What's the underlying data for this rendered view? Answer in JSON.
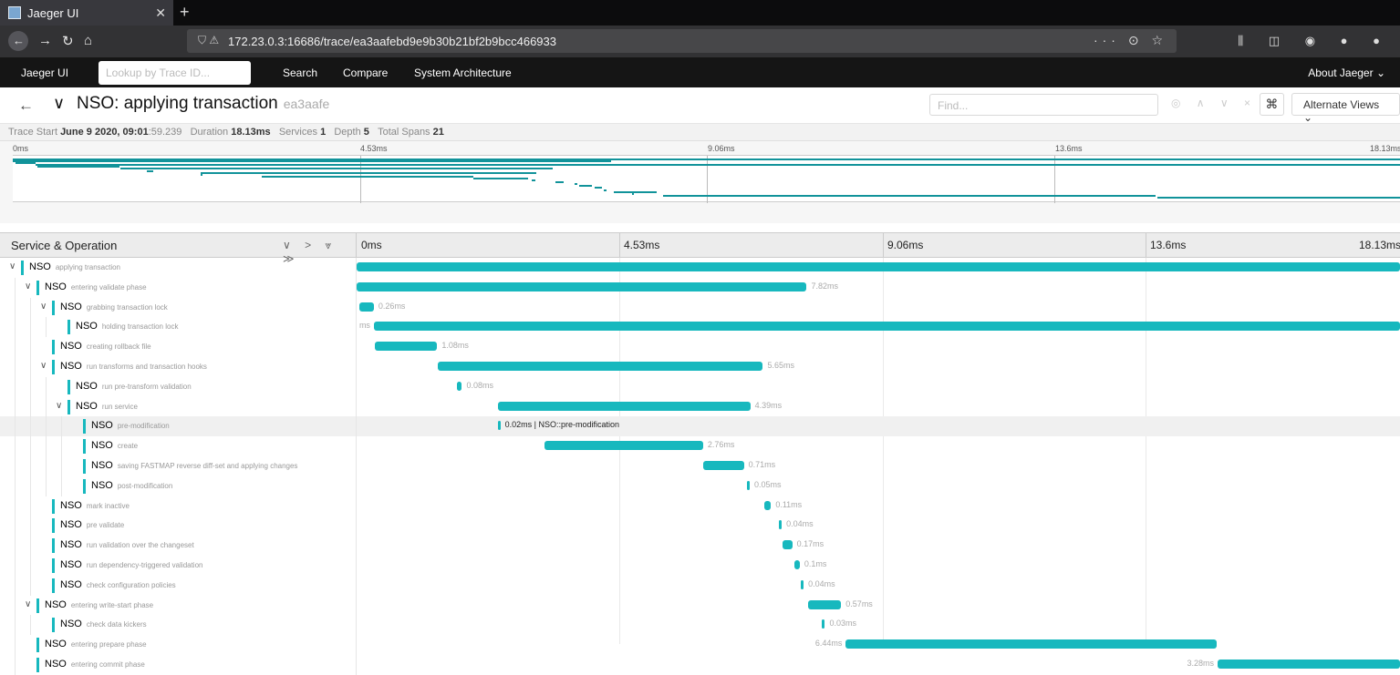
{
  "browser": {
    "tab_title": "Jaeger UI",
    "url": "172.23.0.3:16686/trace/ea3aafebd9e9b30b21bf2b9bcc466933",
    "url_actions": "··· ⊙ ☆",
    "toolbar_icons": "⫼ ◫ ◉ ● ●"
  },
  "app": {
    "brand": "Jaeger UI",
    "lookup_placeholder": "Lookup by Trace ID...",
    "nav": [
      "Search",
      "Compare",
      "System Architecture"
    ],
    "about": "About Jaeger ⌄"
  },
  "trace": {
    "title": "NSO: applying transaction",
    "trace_id_short": "ea3aafe",
    "find_placeholder": "Find...",
    "find_controls": "◎ ∧ ∨ ×",
    "cmd_icon": "⌘",
    "alternate_views": "Alternate Views  ⌄"
  },
  "meta": {
    "trace_start_label": "Trace Start",
    "trace_start_bold": "June 9 2020, 09:01",
    "trace_start_rest": ":59.239",
    "duration_label": "Duration",
    "duration": "18.13ms",
    "services_label": "Services",
    "services": "1",
    "depth_label": "Depth",
    "depth": "5",
    "total_spans_label": "Total Spans",
    "total_spans": "21"
  },
  "minimap": {
    "ticks": [
      "0ms",
      "4.53ms",
      "9.06ms",
      "13.6ms",
      "18.13ms"
    ]
  },
  "timeline": {
    "header_label": "Service & Operation",
    "header_controls": "∨ > ⩔ ≫",
    "ticks": [
      "0ms",
      "4.53ms",
      "9.06ms",
      "13.6ms",
      "18.13ms"
    ]
  },
  "spans": [
    {
      "service": "NSO",
      "operation": "applying transaction",
      "depth": 0,
      "collapsible": true,
      "start_ms": 0.0,
      "duration_ms": 18.13,
      "label": ""
    },
    {
      "service": "NSO",
      "operation": "entering validate phase",
      "depth": 1,
      "collapsible": true,
      "start_ms": 0.0,
      "duration_ms": 7.82,
      "label": "7.82ms"
    },
    {
      "service": "NSO",
      "operation": "grabbing transaction lock",
      "depth": 2,
      "collapsible": true,
      "start_ms": 0.04,
      "duration_ms": 0.26,
      "label": "0.26ms"
    },
    {
      "service": "NSO",
      "operation": "holding transaction lock",
      "depth": 3,
      "collapsible": false,
      "start_ms": 0.3,
      "duration_ms": 17.83,
      "label": "ms",
      "label_left": true
    },
    {
      "service": "NSO",
      "operation": "creating rollback file",
      "depth": 2,
      "collapsible": false,
      "start_ms": 0.32,
      "duration_ms": 1.08,
      "label": "1.08ms"
    },
    {
      "service": "NSO",
      "operation": "run transforms and transaction hooks",
      "depth": 2,
      "collapsible": true,
      "start_ms": 1.41,
      "duration_ms": 5.65,
      "label": "5.65ms"
    },
    {
      "service": "NSO",
      "operation": "run pre-transform validation",
      "depth": 3,
      "collapsible": false,
      "start_ms": 1.75,
      "duration_ms": 0.08,
      "label": "0.08ms"
    },
    {
      "service": "NSO",
      "operation": "run service",
      "depth": 3,
      "collapsible": true,
      "start_ms": 2.45,
      "duration_ms": 4.39,
      "label": "4.39ms"
    },
    {
      "service": "NSO",
      "operation": "pre-modification",
      "depth": 4,
      "collapsible": false,
      "start_ms": 2.45,
      "duration_ms": 0.02,
      "label": "0.02ms | NSO::pre-modification",
      "selected": true
    },
    {
      "service": "NSO",
      "operation": "create",
      "depth": 4,
      "collapsible": false,
      "start_ms": 3.26,
      "duration_ms": 2.76,
      "label": "2.76ms"
    },
    {
      "service": "NSO",
      "operation": "saving FASTMAP reverse diff-set and applying changes",
      "depth": 4,
      "collapsible": false,
      "start_ms": 6.02,
      "duration_ms": 0.71,
      "label": "0.71ms"
    },
    {
      "service": "NSO",
      "operation": "post-modification",
      "depth": 4,
      "collapsible": false,
      "start_ms": 6.78,
      "duration_ms": 0.05,
      "label": "0.05ms"
    },
    {
      "service": "NSO",
      "operation": "mark inactive",
      "depth": 2,
      "collapsible": false,
      "start_ms": 7.09,
      "duration_ms": 0.11,
      "label": "0.11ms"
    },
    {
      "service": "NSO",
      "operation": "pre validate",
      "depth": 2,
      "collapsible": false,
      "start_ms": 7.34,
      "duration_ms": 0.04,
      "label": "0.04ms"
    },
    {
      "service": "NSO",
      "operation": "run validation over the changeset",
      "depth": 2,
      "collapsible": false,
      "start_ms": 7.4,
      "duration_ms": 0.17,
      "label": "0.17ms"
    },
    {
      "service": "NSO",
      "operation": "run dependency-triggered validation",
      "depth": 2,
      "collapsible": false,
      "start_ms": 7.6,
      "duration_ms": 0.1,
      "label": "0.1ms"
    },
    {
      "service": "NSO",
      "operation": "check configuration policies",
      "depth": 2,
      "collapsible": false,
      "start_ms": 7.72,
      "duration_ms": 0.04,
      "label": "0.04ms"
    },
    {
      "service": "NSO",
      "operation": "entering write-start phase",
      "depth": 1,
      "collapsible": true,
      "start_ms": 7.85,
      "duration_ms": 0.57,
      "label": "0.57ms"
    },
    {
      "service": "NSO",
      "operation": "check data kickers",
      "depth": 2,
      "collapsible": false,
      "start_ms": 8.09,
      "duration_ms": 0.03,
      "label": "0.03ms"
    },
    {
      "service": "NSO",
      "operation": "entering prepare phase",
      "depth": 1,
      "collapsible": false,
      "start_ms": 8.5,
      "duration_ms": 6.44,
      "label": "6.44ms",
      "label_left": true
    },
    {
      "service": "NSO",
      "operation": "entering commit phase",
      "depth": 1,
      "collapsible": false,
      "start_ms": 14.96,
      "duration_ms": 3.17,
      "label": "3.28ms",
      "label_left": true
    }
  ]
}
